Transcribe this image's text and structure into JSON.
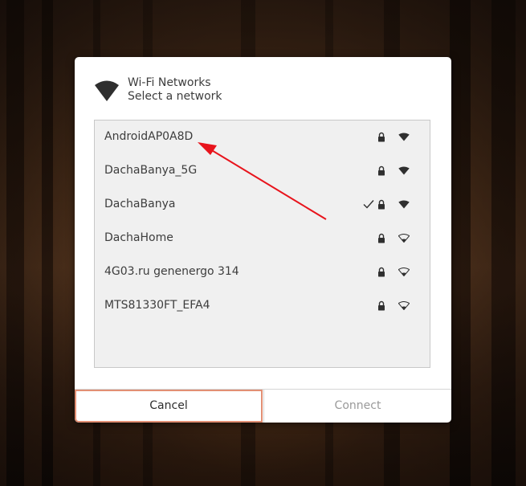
{
  "dialog": {
    "title": "Wi-Fi Networks",
    "subtitle": "Select a network"
  },
  "networks": [
    {
      "name": "AndroidAP0A8D",
      "connected": false,
      "secured": true,
      "signal": "full",
      "icon_lock": "lock-icon",
      "icon_signal": "wifi-signal-full-icon"
    },
    {
      "name": "DachaBanya_5G",
      "connected": false,
      "secured": true,
      "signal": "full",
      "icon_lock": "lock-icon",
      "icon_signal": "wifi-signal-full-icon"
    },
    {
      "name": "DachaBanya",
      "connected": true,
      "secured": true,
      "signal": "full",
      "icon_lock": "lock-icon",
      "icon_signal": "wifi-signal-full-icon"
    },
    {
      "name": "DachaHome",
      "connected": false,
      "secured": true,
      "signal": "weak",
      "icon_lock": "lock-icon",
      "icon_signal": "wifi-signal-weak-icon"
    },
    {
      "name": "4G03.ru genenergo 314",
      "connected": false,
      "secured": true,
      "signal": "weak",
      "icon_lock": "lock-icon",
      "icon_signal": "wifi-signal-weak-icon"
    },
    {
      "name": "MTS81330FT_EFA4",
      "connected": false,
      "secured": true,
      "signal": "weak",
      "icon_lock": "lock-icon",
      "icon_signal": "wifi-signal-weak-icon"
    }
  ],
  "buttons": {
    "cancel": "Cancel",
    "connect": "Connect"
  },
  "colors": {
    "annotation_arrow": "#e8141c",
    "focus_border": "#e28f74",
    "disabled_text": "#9a9a9a"
  }
}
